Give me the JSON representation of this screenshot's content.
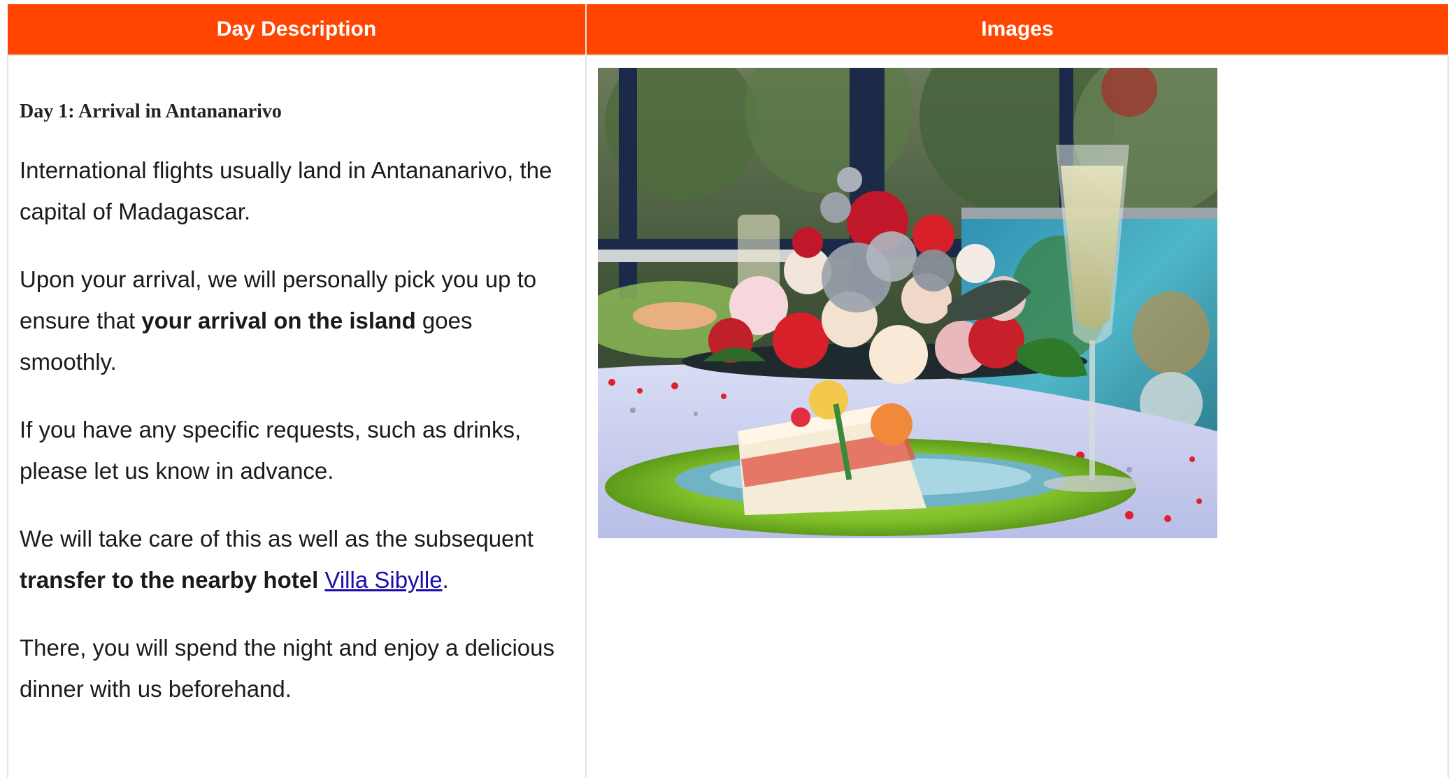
{
  "table": {
    "headers": {
      "description": "Day Description",
      "images": "Images"
    },
    "header_color": "#ff4500"
  },
  "day": {
    "title": "Day 1: Arrival in Antananarivo",
    "p1": "International flights usually land in Antananarivo, the capital of Madagascar.",
    "p2_before": "Upon your arrival, we will personally pick you up to ensure that ",
    "p2_bold": "your arrival on the island",
    "p2_after": " goes smoothly.",
    "p3": "If you have any specific requests, such as drinks, please let us know in advance.",
    "p4_before": "We will take care of this as well as the subsequent ",
    "p4_bold": "transfer to the nearby hotel",
    "p4_space": " ",
    "p4_link": "Villa Sibylle",
    "p4_after": ".",
    "p5": "There, you will spend the night and enjoy a delicious dinner with us beforehand.",
    "link_color": "#1a0dab"
  },
  "photo": {
    "icon": "dinner-table-photo"
  }
}
